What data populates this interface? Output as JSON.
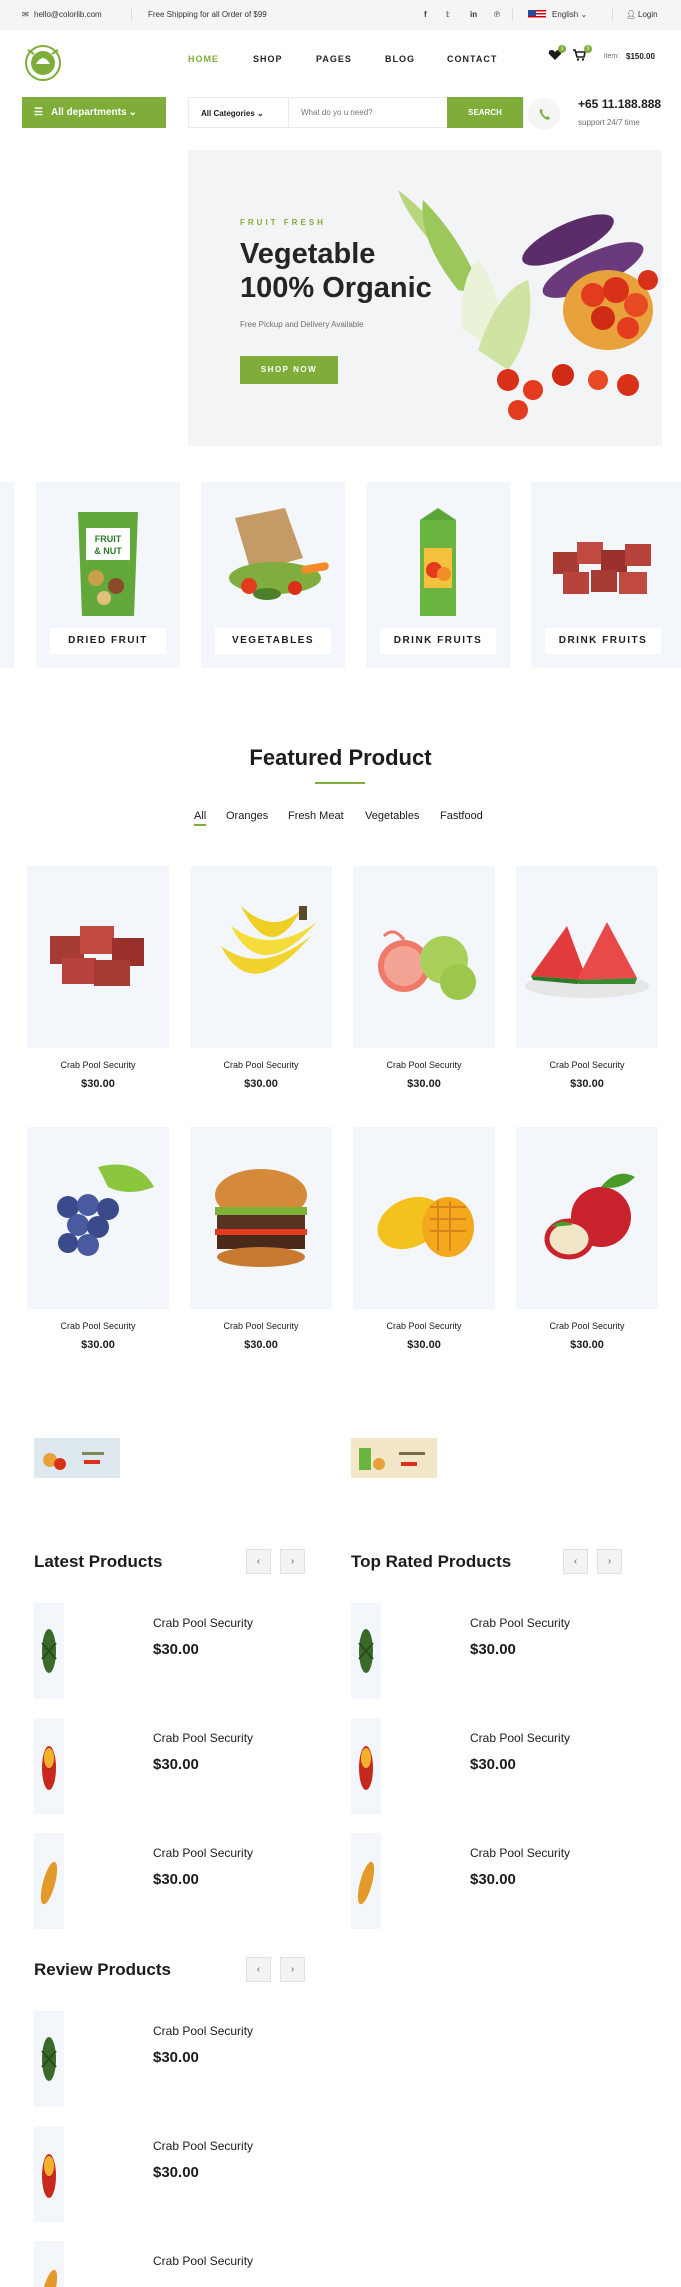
{
  "topbar": {
    "email": "hello@colorlib.com",
    "shipping": "Free Shipping for all Order of $99",
    "language": "English",
    "login": "Login"
  },
  "nav": {
    "home": "HOME",
    "shop": "SHOP",
    "pages": "PAGES",
    "blog": "BLOG",
    "contact": "CONTACT",
    "fav_count": "1",
    "cart_count": "3",
    "item_label": "item:",
    "item_total": "$150.00"
  },
  "hero": {
    "departments": "All departments",
    "category": "All Categories",
    "search_placeholder": "What do yo u need?",
    "search_button": "SEARCH",
    "phone": "+65 11.188.888",
    "support": "support 24/7 time",
    "eyebrow": "FRUIT FRESH",
    "title_line1": "Vegetable",
    "title_line2": "100% Organic",
    "subtitle": "Free Pickup and Delivery Available",
    "cta": "SHOP NOW"
  },
  "categories": [
    "DRIED FRUIT",
    "VEGETABLES",
    "DRINK FRUITS",
    "DRINK FRUITS"
  ],
  "featured": {
    "title": "Featured Product",
    "filters": [
      "All",
      "Oranges",
      "Fresh Meat",
      "Vegetables",
      "Fastfood"
    ],
    "products": [
      {
        "name": "Crab Pool Security",
        "price": "$30.00",
        "image": "meat"
      },
      {
        "name": "Crab Pool Security",
        "price": "$30.00",
        "image": "banana"
      },
      {
        "name": "Crab Pool Security",
        "price": "$30.00",
        "image": "guava"
      },
      {
        "name": "Crab Pool Security",
        "price": "$30.00",
        "image": "watermelon"
      },
      {
        "name": "Crab Pool Security",
        "price": "$30.00",
        "image": "grapes"
      },
      {
        "name": "Crab Pool Security",
        "price": "$30.00",
        "image": "burger"
      },
      {
        "name": "Crab Pool Security",
        "price": "$30.00",
        "image": "mango"
      },
      {
        "name": "Crab Pool Security",
        "price": "$30.00",
        "image": "apple"
      }
    ]
  },
  "lists": {
    "latest": {
      "title": "Latest Products",
      "items": [
        {
          "name": "Crab Pool Security",
          "price": "$30.00"
        },
        {
          "name": "Crab Pool Security",
          "price": "$30.00"
        },
        {
          "name": "Crab Pool Security",
          "price": "$30.00"
        }
      ]
    },
    "top": {
      "title": "Top Rated Products",
      "items": [
        {
          "name": "Crab Pool Security",
          "price": "$30.00"
        },
        {
          "name": "Crab Pool Security",
          "price": "$30.00"
        },
        {
          "name": "Crab Pool Security",
          "price": "$30.00"
        }
      ]
    },
    "review": {
      "title": "Review Products",
      "items": [
        {
          "name": "Crab Pool Security",
          "price": "$30.00"
        },
        {
          "name": "Crab Pool Security",
          "price": "$30.00"
        },
        {
          "name": "Crab Pool Security"
        }
      ]
    }
  },
  "colors": {
    "accent": "#7fad39",
    "card_bg": "#f3f6fa"
  }
}
